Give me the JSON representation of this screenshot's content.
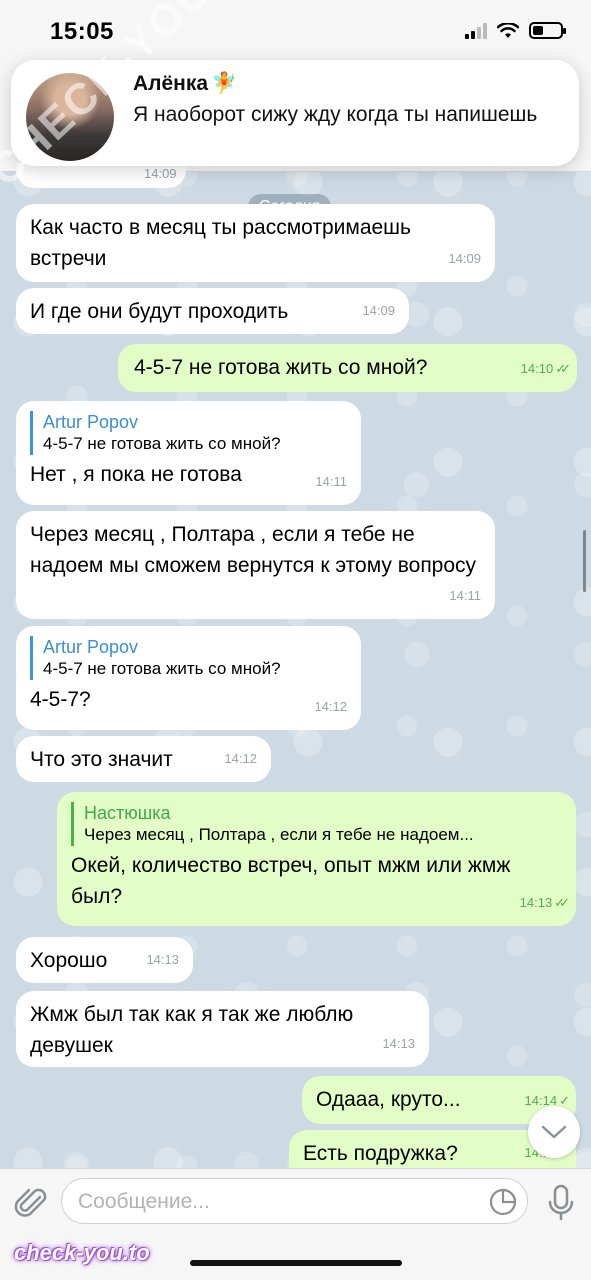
{
  "status_bar": {
    "time": "15:05"
  },
  "notification": {
    "sender": "Алёнка",
    "sender_emoji": "🧚",
    "text": "Я наоборот сижу жду когда ты напишешь"
  },
  "date_divider": "Сегодня",
  "partial_message_time": "14:09",
  "messages": [
    {
      "dir": "in",
      "text": "Как часто в месяц ты рассмотримаешь встречи",
      "time": "14:09"
    },
    {
      "dir": "in",
      "text": "И где они будут проходить",
      "time": "14:09"
    },
    {
      "dir": "out",
      "text": "4-5-7 не готова жить со мной?",
      "time": "14:10"
    },
    {
      "dir": "in",
      "reply_author": "Artur Popov",
      "reply_text": "4-5-7 не готова жить со мной?",
      "text": "Нет , я пока не готова",
      "time": "14:11"
    },
    {
      "dir": "in",
      "text": "Через месяц , Полтара , если я тебе не надоем мы сможем вернутся к этому вопросу",
      "time": "14:11"
    },
    {
      "dir": "in",
      "reply_author": "Artur Popov",
      "reply_text": "4-5-7 не готова жить со мной?",
      "text": "4-5-7?",
      "time": "14:12"
    },
    {
      "dir": "in",
      "text": "Что это значит",
      "time": "14:12"
    },
    {
      "dir": "out",
      "reply_author": "Настюшка",
      "reply_text": "Через месяц , Полтара , если я тебе не надоем...",
      "text": "Окей, количество встреч, опыт мжм или жмж был?",
      "time": "14:13"
    },
    {
      "dir": "in",
      "text": "Хорошо",
      "time": "14:13"
    },
    {
      "dir": "in",
      "text": "Жмж был так как я так же люблю девушек",
      "time": "14:13"
    },
    {
      "dir": "out",
      "text": "Одааа, круто...",
      "time": "14:14"
    },
    {
      "dir": "out",
      "text": "Есть подружка?",
      "time": "14:14"
    }
  ],
  "composer": {
    "placeholder": "Сообщение..."
  },
  "watermarks": {
    "bottom": "check-you.to",
    "diagonal": "CHECK-YOU.ME"
  },
  "colors": {
    "incoming": "#ffffff",
    "outgoing": "#e2fec6",
    "accent": "#3b8fd0"
  }
}
